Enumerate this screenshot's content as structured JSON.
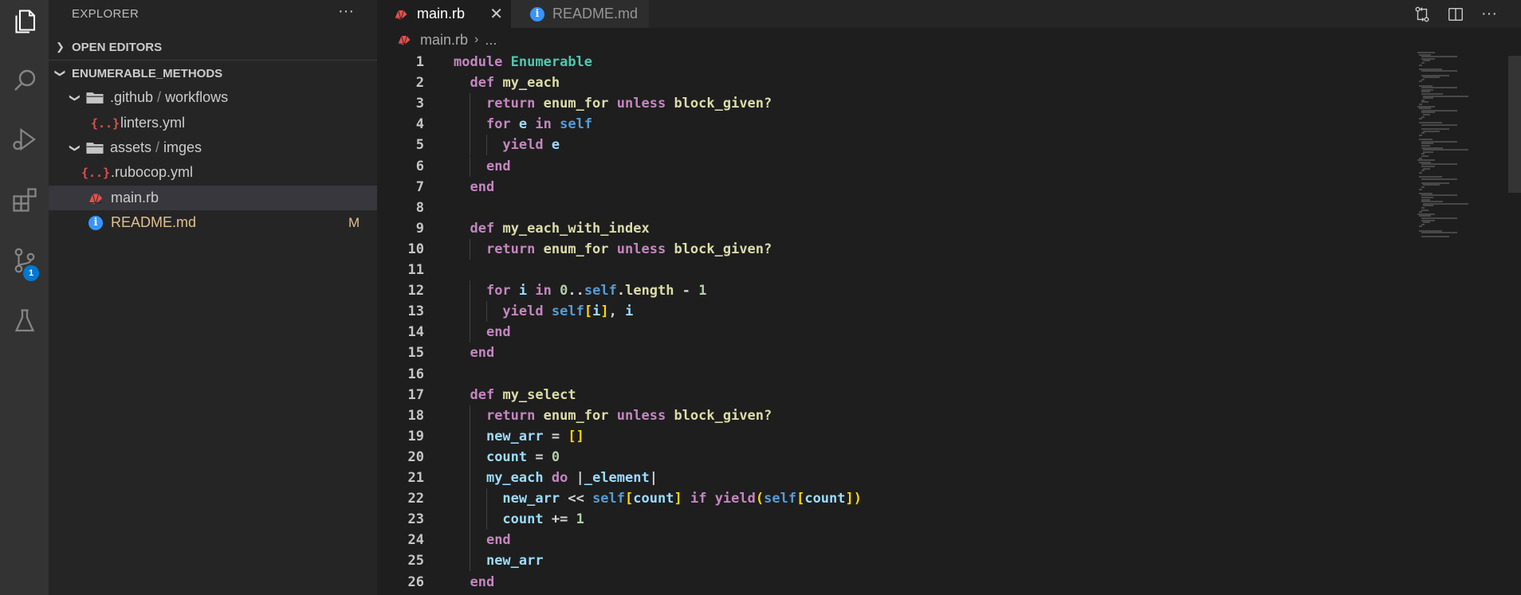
{
  "activity_bar": {
    "items": [
      {
        "name": "explorer",
        "icon": "files-icon"
      },
      {
        "name": "search",
        "icon": "search-icon"
      },
      {
        "name": "run-debug",
        "icon": "run-debug-icon"
      },
      {
        "name": "extensions",
        "icon": "extensions-icon"
      },
      {
        "name": "source-control",
        "icon": "source-control-icon",
        "badge": "1"
      },
      {
        "name": "testing",
        "icon": "flask-icon"
      }
    ]
  },
  "sidebar": {
    "title": "EXPLORER",
    "more": "···",
    "open_editors": "OPEN EDITORS",
    "project": "ENUMERABLE_METHODS",
    "tree": [
      {
        "type": "folder",
        "parts": [
          ".github",
          "workflows"
        ]
      },
      {
        "type": "file",
        "icon": "yaml-icon",
        "glyph": "{..}",
        "label": "linters.yml"
      },
      {
        "type": "folder",
        "parts": [
          "assets",
          "imges"
        ]
      },
      {
        "type": "file",
        "icon": "yaml-icon",
        "glyph": "{..}",
        "label": ".rubocop.yml"
      },
      {
        "type": "file",
        "icon": "ruby-icon",
        "label": "main.rb",
        "selected": true
      },
      {
        "type": "file",
        "icon": "info-icon",
        "glyph": "i",
        "label": "README.md",
        "status": "M"
      }
    ]
  },
  "tabs": [
    {
      "label": "main.rb",
      "active": true,
      "close": "✕",
      "icon": "ruby-icon"
    },
    {
      "label": "README.md",
      "active": false,
      "icon": "info-icon",
      "glyph": "i"
    }
  ],
  "tab_actions": [
    "compare-changes-icon",
    "split-editor-icon",
    "more-actions-icon"
  ],
  "more_actions_glyph": "···",
  "breadcrumb": {
    "file": "main.rb",
    "sep": "›",
    "rest": "..."
  },
  "editor": {
    "lines": [
      {
        "n": "1",
        "text": "module Enumerable"
      },
      {
        "n": "2",
        "text": "  def my_each"
      },
      {
        "n": "3",
        "text": "    return enum_for unless block_given?"
      },
      {
        "n": "4",
        "text": "    for e in self"
      },
      {
        "n": "5",
        "text": "      yield e"
      },
      {
        "n": "6",
        "text": "    end"
      },
      {
        "n": "7",
        "text": "  end"
      },
      {
        "n": "8",
        "text": ""
      },
      {
        "n": "9",
        "text": "  def my_each_with_index"
      },
      {
        "n": "10",
        "text": "    return enum_for unless block_given?"
      },
      {
        "n": "11",
        "text": ""
      },
      {
        "n": "12",
        "text": "    for i in 0..self.length - 1"
      },
      {
        "n": "13",
        "text": "      yield self[i], i"
      },
      {
        "n": "14",
        "text": "    end"
      },
      {
        "n": "15",
        "text": "  end"
      },
      {
        "n": "16",
        "text": ""
      },
      {
        "n": "17",
        "text": "  def my_select"
      },
      {
        "n": "18",
        "text": "    return enum_for unless block_given?"
      },
      {
        "n": "19",
        "text": "    new_arr = []"
      },
      {
        "n": "20",
        "text": "    count = 0"
      },
      {
        "n": "21",
        "text": "    my_each do |_element|"
      },
      {
        "n": "22",
        "text": "      new_arr << self[count] if yield(self[count])"
      },
      {
        "n": "23",
        "text": "      count += 1"
      },
      {
        "n": "24",
        "text": "    end"
      },
      {
        "n": "25",
        "text": "    new_arr"
      },
      {
        "n": "26",
        "text": "  end"
      }
    ]
  },
  "colors": {
    "keyword": "#c586c0",
    "function": "#dcdcaa",
    "class": "#4ec9b0",
    "variable": "#9cdcfe",
    "self": "#569cd6",
    "number": "#b5cea8",
    "bracket": "#ffd700",
    "modified": "#e2c08d",
    "accent": "#0078d4"
  }
}
